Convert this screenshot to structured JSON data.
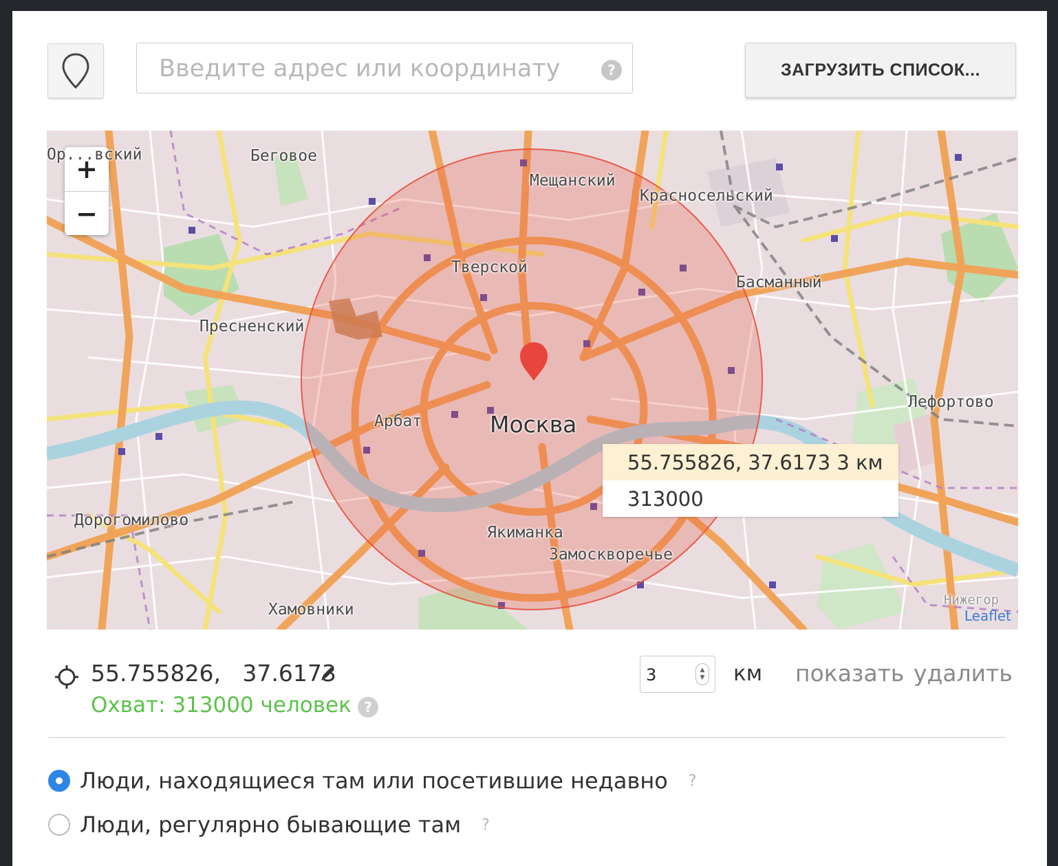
{
  "search": {
    "placeholder": "Введите адрес или координату",
    "help": "?"
  },
  "toolbar": {
    "pin_icon": "map-pin-icon",
    "load_label": "ЗАГРУЗИТЬ СПИСОК..."
  },
  "map": {
    "zoom_in": "+",
    "zoom_out": "−",
    "center_city": "Москва",
    "districts": [
      "Ор...вский",
      "Беговое",
      "Мещанский",
      "Красносельский",
      "Тверской",
      "Басманный",
      "Пресненский",
      "Арбат",
      "Лефортово",
      "Дорогомилово",
      "Якиманка",
      "Замоскворечье",
      "Хамовники",
      "Нижегор"
    ],
    "tooltip": {
      "line1": "55.755826, 37.6173 3 км",
      "line2": "313000"
    },
    "attribution": "Leaflet",
    "circle_color": "#e8503c",
    "marker_color": "#e8453c"
  },
  "point": {
    "coordinates": "55.755826,   37.6173",
    "coverage": "Охват: 313000 человек",
    "coverage_help": "?",
    "radius_value": "3",
    "radius_unit": "км",
    "show_label": "показать",
    "delete_label": "удалить"
  },
  "options": [
    {
      "label": "Люди, находящиеся там или посетившие недавно",
      "help": "?",
      "selected": true
    },
    {
      "label": "Люди, регулярно бывающие там",
      "help": "?",
      "selected": false
    }
  ],
  "colors": {
    "accent": "#2d86e6",
    "coverage_green": "#5cc34a",
    "muted_link": "#8a8a8a"
  }
}
